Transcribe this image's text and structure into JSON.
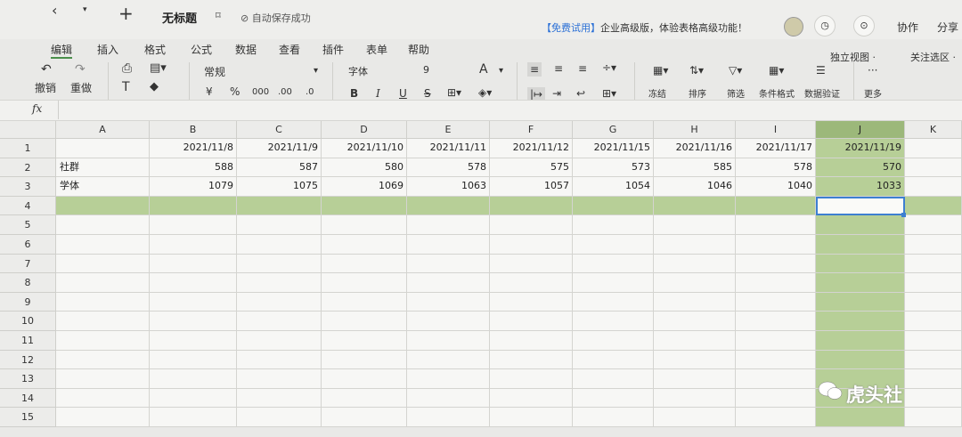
{
  "topbar": {
    "back": "‹",
    "dropdown": "▾",
    "new": "+",
    "title": "无标题",
    "bookmark": "⌑",
    "save_status": "⊘ 自动保存成功",
    "promo_highlight": "【免费试用】",
    "promo_text": "企业高级版，体验表格高级功能！",
    "history_icon": "◷",
    "present_icon": "⊙",
    "collab": "协作",
    "share": "分享"
  },
  "menu": [
    "编辑",
    "插入",
    "格式",
    "公式",
    "数据",
    "查看",
    "插件",
    "表单",
    "帮助"
  ],
  "view_controls": {
    "independent_view": "独立视图 ·",
    "focus_selection": "关注选区 ·"
  },
  "toolbar": {
    "undo": "撤销",
    "redo": "重做",
    "number_format": "常规",
    "currency": "¥",
    "percent": "%",
    "thousands": "000",
    "dec_add": ".00",
    "dec_remove": ".0",
    "font": "字体",
    "font_size": "9",
    "bold": "B",
    "italic": "I",
    "underline": "U",
    "strike": "S",
    "freeze": "冻结",
    "sort": "排序",
    "filter": "筛选",
    "cond_format": "条件格式",
    "validation": "数据验证",
    "more": "更多",
    "more_dots": "···"
  },
  "formula_bar": {
    "fx": "fx",
    "value": ""
  },
  "sheet": {
    "columns": [
      "A",
      "B",
      "C",
      "D",
      "E",
      "F",
      "G",
      "H",
      "I",
      "J",
      "K"
    ],
    "rows": [
      "1",
      "2",
      "3",
      "4",
      "5",
      "6",
      "7",
      "8",
      "9",
      "10",
      "11",
      "12",
      "13",
      "14",
      "15"
    ],
    "selected_column": "J",
    "highlighted_row": "4",
    "cells": {
      "row1": [
        "",
        "2021/11/8",
        "2021/11/9",
        "2021/11/10",
        "2021/11/11",
        "2021/11/12",
        "2021/11/15",
        "2021/11/16",
        "2021/11/17",
        "2021/11/19",
        ""
      ],
      "row2": [
        "社群",
        "588",
        "587",
        "580",
        "578",
        "575",
        "573",
        "585",
        "578",
        "570",
        ""
      ],
      "row3": [
        "学体",
        "1079",
        "1075",
        "1069",
        "1063",
        "1057",
        "1054",
        "1046",
        "1040",
        "1033",
        ""
      ]
    }
  },
  "watermark": "虎头社",
  "colors": {
    "selection_green": "#b7cf97",
    "active_border": "#3d7fd1",
    "promo_blue": "#2a6fd6"
  }
}
